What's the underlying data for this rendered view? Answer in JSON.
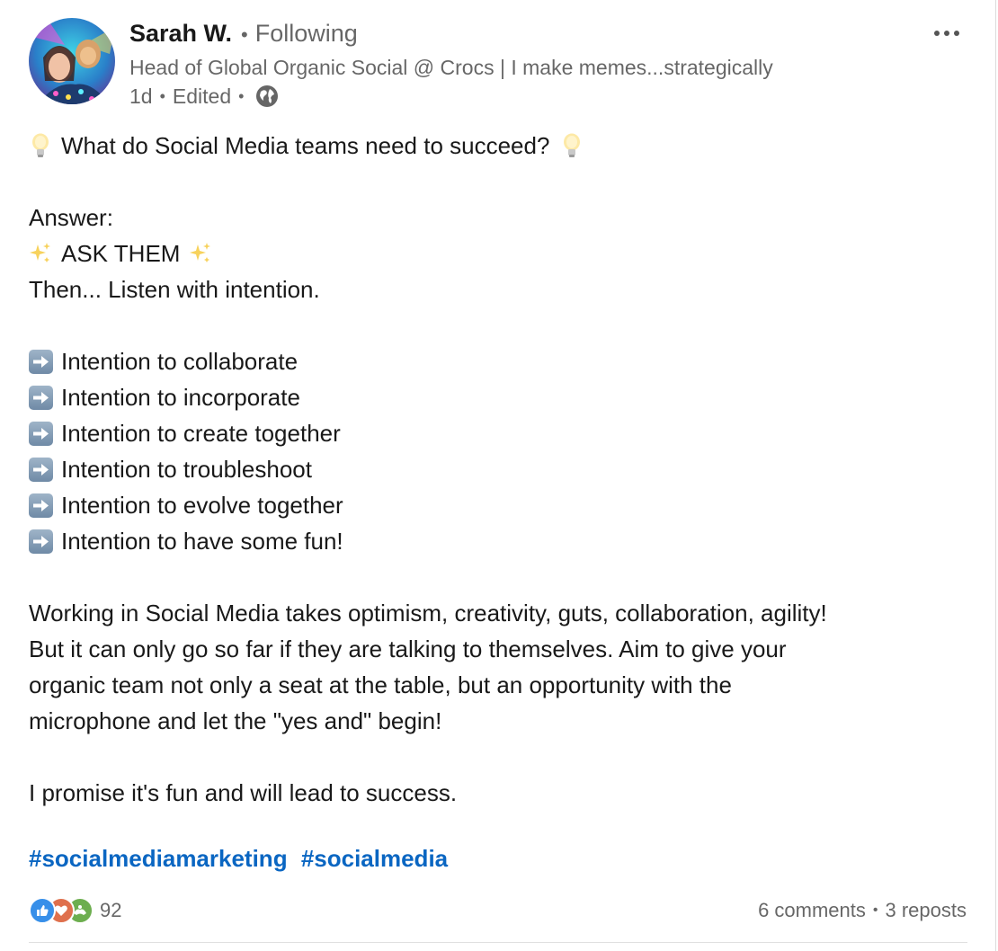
{
  "author": {
    "name": "Sarah W.",
    "follow_status": "Following",
    "headline": "Head of Global Organic Social @ Crocs | I make memes...strategically",
    "time_ago": "1d",
    "edited": "Edited",
    "visibility_icon": "globe-icon"
  },
  "more_icon": "more-horizontal-icon",
  "post": {
    "question": "What do Social Media teams need to succeed?",
    "answer_label": "Answer:",
    "ask_them": "ASK THEM",
    "listen": "Then... Listen with intention.",
    "intentions": [
      "Intention to collaborate",
      "Intention to incorporate",
      "Intention to create together",
      "Intention to troubleshoot",
      "Intention to evolve together",
      "Intention to have some fun!"
    ],
    "paragraph_lines": [
      "Working in Social Media takes optimism, creativity, guts, collaboration, agility!",
      "But it can only go so far if they are talking to themselves. Aim to give your",
      "organic team not only a seat at the table, but an opportunity with the",
      "microphone and let the \"yes and\" begin!"
    ],
    "closing": "I promise it's fun and will lead to success.",
    "hashtags": [
      "#socialmediamarketing",
      "#socialmedia"
    ]
  },
  "footer": {
    "reaction_icons": [
      "like-icon",
      "love-icon",
      "support-icon"
    ],
    "reaction_count": "92",
    "comments": "6 comments",
    "reposts": "3 reposts"
  },
  "colors": {
    "link": "#0a66c2",
    "like": "#378fe9",
    "love": "#df704d",
    "support": "#6dae4f"
  }
}
